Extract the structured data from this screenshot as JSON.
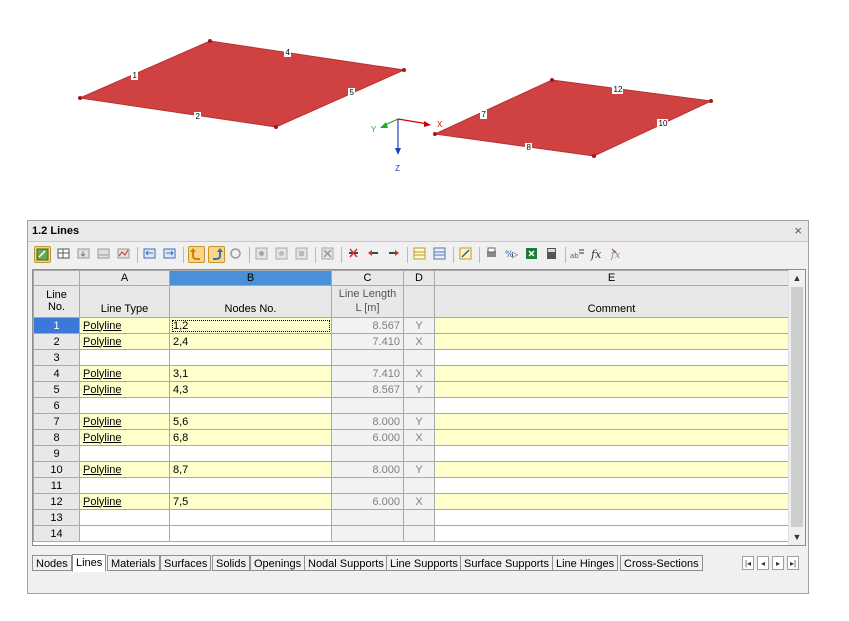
{
  "viewport": {
    "axes": {
      "x": "X",
      "y": "Y",
      "z": "Z"
    },
    "line_labels": [
      "1",
      "2",
      "4",
      "5",
      "7",
      "8",
      "10",
      "12"
    ],
    "surface_color": "#d04242",
    "axis_colors": {
      "x": "#cc0000",
      "y": "#22aa22",
      "z": "#1f3fbf"
    }
  },
  "panel": {
    "title": "1.2 Lines",
    "close_glyph": "×"
  },
  "grid": {
    "column_letters": [
      "A",
      "B",
      "C",
      "D",
      "E"
    ],
    "row_header_label_line1": "Line",
    "row_header_label_line2": "No.",
    "headers": {
      "line_type": "Line Type",
      "nodes_no": "Nodes No.",
      "line_length_1": "Line Length",
      "line_length_2": "L [m]",
      "comment": "Comment"
    },
    "rows": [
      {
        "no": "1",
        "type": "Polyline",
        "nodes": "1,2",
        "length": "8.567",
        "axis": "Y"
      },
      {
        "no": "2",
        "type": "Polyline",
        "nodes": "2,4",
        "length": "7.410",
        "axis": "X"
      },
      {
        "no": "3",
        "type": "",
        "nodes": "",
        "length": "",
        "axis": ""
      },
      {
        "no": "4",
        "type": "Polyline",
        "nodes": "3,1",
        "length": "7.410",
        "axis": "X"
      },
      {
        "no": "5",
        "type": "Polyline",
        "nodes": "4,3",
        "length": "8.567",
        "axis": "Y"
      },
      {
        "no": "6",
        "type": "",
        "nodes": "",
        "length": "",
        "axis": ""
      },
      {
        "no": "7",
        "type": "Polyline",
        "nodes": "5,6",
        "length": "8.000",
        "axis": "Y"
      },
      {
        "no": "8",
        "type": "Polyline",
        "nodes": "6,8",
        "length": "6.000",
        "axis": "X"
      },
      {
        "no": "9",
        "type": "",
        "nodes": "",
        "length": "",
        "axis": ""
      },
      {
        "no": "10",
        "type": "Polyline",
        "nodes": "8,7",
        "length": "8.000",
        "axis": "Y"
      },
      {
        "no": "11",
        "type": "",
        "nodes": "",
        "length": "",
        "axis": ""
      },
      {
        "no": "12",
        "type": "Polyline",
        "nodes": "7,5",
        "length": "6.000",
        "axis": "X"
      },
      {
        "no": "13",
        "type": "",
        "nodes": "",
        "length": "",
        "axis": ""
      },
      {
        "no": "14",
        "type": "",
        "nodes": "",
        "length": "",
        "axis": ""
      }
    ]
  },
  "tabs": [
    "Nodes",
    "Lines",
    "Materials",
    "Surfaces",
    "Solids",
    "Openings",
    "Nodal Supports",
    "Line Supports",
    "Surface Supports",
    "Line Hinges",
    "Cross-Sections"
  ],
  "active_tab": "Lines",
  "scroll": {
    "up": "▲",
    "down": "▼"
  },
  "tab_nav": [
    "|◂",
    "◂",
    "▸",
    "▸|"
  ]
}
